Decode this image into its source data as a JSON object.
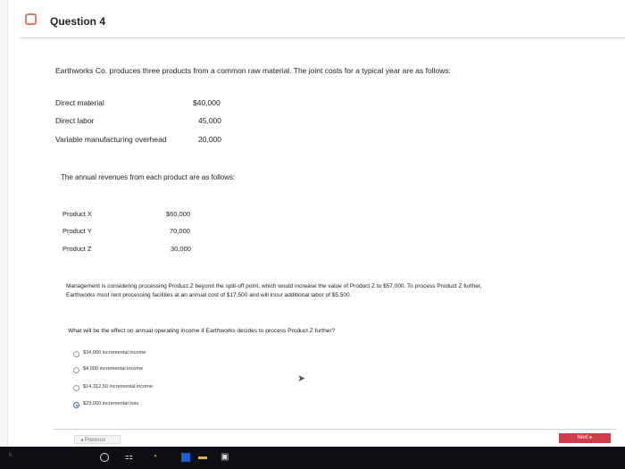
{
  "header": {
    "question_title": "Question 4"
  },
  "intro_text": "Earthworks Co. produces three products from a common raw material. The joint costs for a typical year are as follows:",
  "joint_costs": [
    {
      "label": "Direct material",
      "value": "$40,000"
    },
    {
      "label": "Direct labor",
      "value": "45,000"
    },
    {
      "label": "Variable manufacturing overhead",
      "value": "20,000"
    }
  ],
  "revenues_text": "The annual revenues from each product are as follows:",
  "revenues": [
    {
      "label": "Product X",
      "value": "$60,000"
    },
    {
      "label": "Product Y",
      "value": "70,000"
    },
    {
      "label": "Product Z",
      "value": "30,000"
    }
  ],
  "management_text_line1": "Management is considering processing Product Z beyond the split-off point, which would increase the value of Product Z to $57,000. To process Product Z further,",
  "management_text_line2": "Earthworks must rent processing facilities at an annual cost of $17,500 and will incur additional labor of $5,500.",
  "question_text": "What will be the effect on annual operating income if Earthworks decides to process Product Z further?",
  "choices": [
    {
      "label": "$34,000 incremental income",
      "selected": false
    },
    {
      "label": "$4,000 incremental income",
      "selected": false
    },
    {
      "label": "$14,312.50 incremental income",
      "selected": false
    },
    {
      "label": "$23,000 incremental loss",
      "selected": true
    }
  ],
  "nav": {
    "previous_label": "Previous",
    "next_label": "Next"
  },
  "taskbar": {
    "left_text": "h"
  },
  "colors": {
    "accent_red": "#cf3d4a",
    "flag": "#e07b6a",
    "radio_selected": "#2b6cb0"
  }
}
